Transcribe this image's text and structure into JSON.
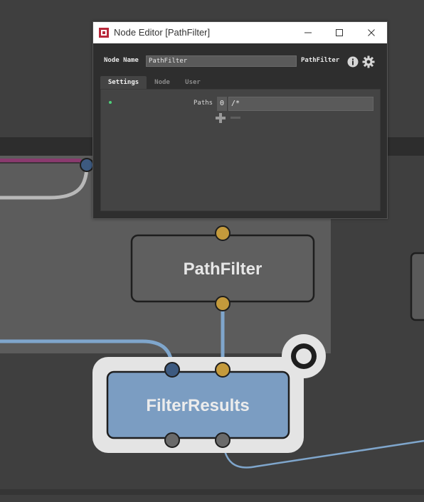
{
  "graph": {
    "nodes": [
      {
        "id": "pathfilter",
        "title": "PathFilter"
      },
      {
        "id": "filterresults",
        "title": "FilterResults"
      }
    ],
    "colors": {
      "background": "#3f3f3f",
      "backdrop": "#5c5c5c",
      "pathfilter_fill": "#5f5f5f",
      "filterresults_fill": "#7b9dc2",
      "plug_gold": "#c49a3c",
      "plug_blue": "#3d5a80",
      "plug_grey": "#6a6a6a",
      "wire_blue": "#7fa6cc",
      "wire_grey": "#b8b8b8",
      "wire_magenta": "#8a3a6e"
    }
  },
  "editor": {
    "title": "Node Editor [PathFilter]",
    "window_buttons": {
      "minimize": "—",
      "maximize": "☐",
      "close": "✕"
    },
    "node_name_label": "Node Name",
    "node_name_value": "PathFilter",
    "node_type": "PathFilter",
    "tabs": [
      {
        "label": "Settings",
        "active": true
      },
      {
        "label": "Node",
        "active": false
      },
      {
        "label": "User",
        "active": false
      }
    ],
    "paths": {
      "label": "Paths",
      "index": "0",
      "value": "/*"
    }
  }
}
